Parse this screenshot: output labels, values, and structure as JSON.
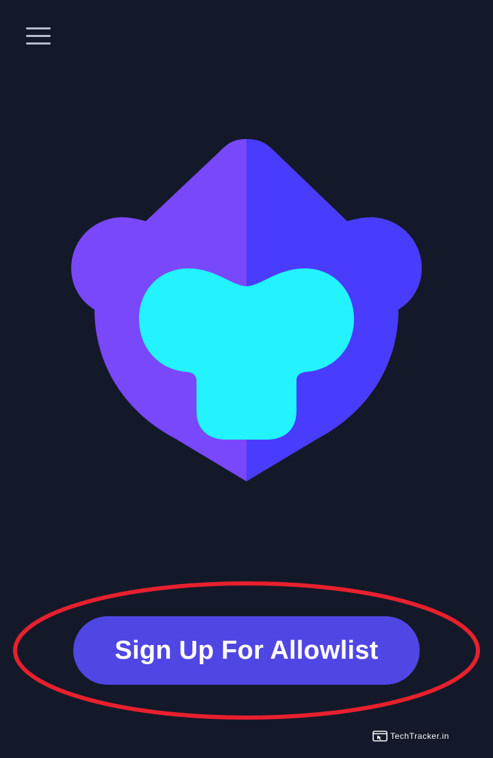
{
  "app": {
    "background_color": "#131928"
  },
  "header": {
    "menu_icon": "hamburger-menu-icon"
  },
  "logo": {
    "icon": "monkey-head-logo",
    "colors": {
      "left_half": "#7a48fb",
      "right_half": "#4a3cfc",
      "face": "#22f3fd"
    }
  },
  "cta": {
    "signup_label": "Sign Up For Allowlist",
    "button_color": "#5046e4",
    "annotation_color": "#e8202e"
  },
  "watermark": {
    "text": "TechTracker.in",
    "icon": "browser-window-icon"
  }
}
